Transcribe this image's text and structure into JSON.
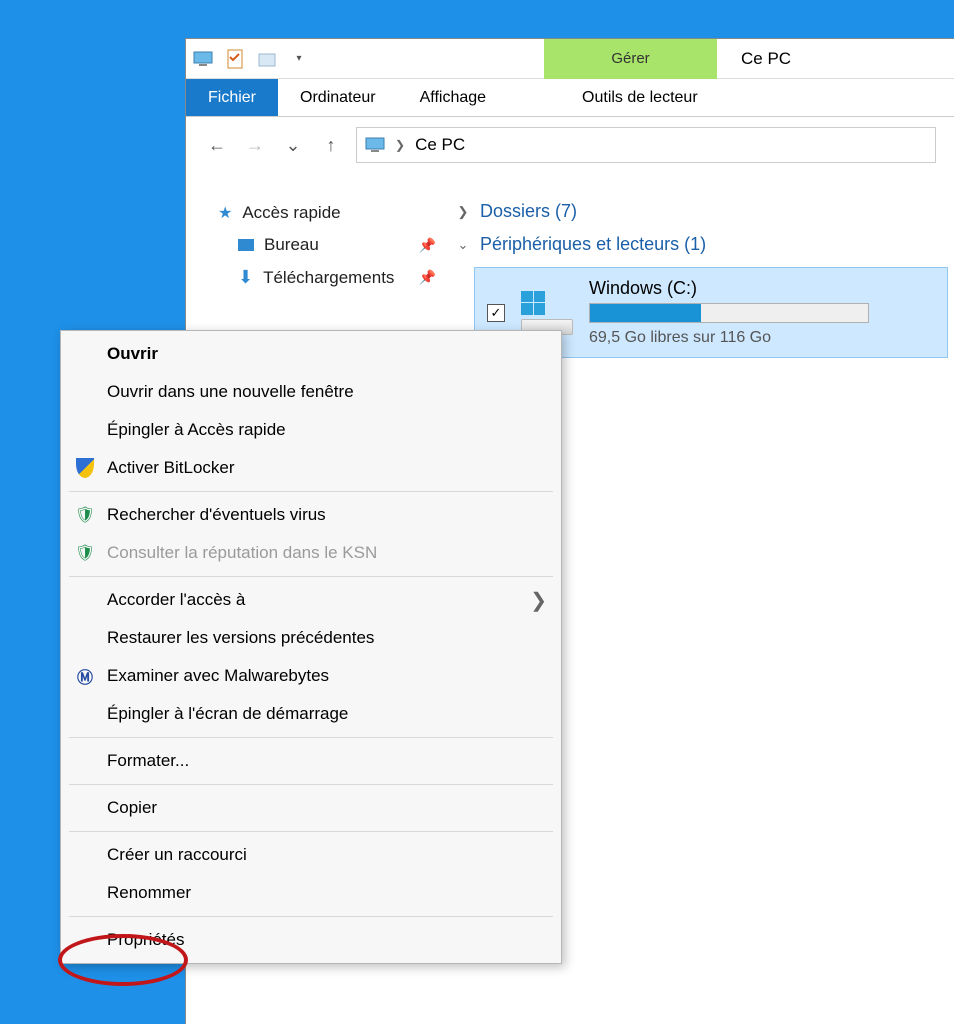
{
  "window": {
    "title": "Ce PC"
  },
  "titlebar": {
    "manage_label": "Gérer"
  },
  "ribbon": {
    "file": "Fichier",
    "computer": "Ordinateur",
    "view": "Affichage",
    "drive_tools": "Outils de lecteur"
  },
  "breadcrumb": {
    "root": "Ce PC"
  },
  "sidebar": {
    "quick_access": "Accès rapide",
    "desktop": "Bureau",
    "downloads": "Téléchargements"
  },
  "content": {
    "folders_group": "Dossiers (7)",
    "devices_group": "Périphériques et lecteurs (1)",
    "drive": {
      "name": "Windows (C:)",
      "status": "69,5 Go libres sur 116 Go",
      "fill_percent": 40
    }
  },
  "context_menu": {
    "open": "Ouvrir",
    "open_new_window": "Ouvrir dans une nouvelle fenêtre",
    "pin_quick_access": "Épingler à Accès rapide",
    "activate_bitlocker": "Activer BitLocker",
    "scan_virus": "Rechercher d'éventuels virus",
    "ksn_reputation": "Consulter la réputation dans le KSN",
    "grant_access": "Accorder l'accès à",
    "restore_versions": "Restaurer les versions précédentes",
    "malwarebytes": "Examiner avec Malwarebytes",
    "pin_start": "Épingler à l'écran de démarrage",
    "format": "Formater...",
    "copy": "Copier",
    "create_shortcut": "Créer un raccourci",
    "rename": "Renommer",
    "properties": "Propriétés"
  }
}
